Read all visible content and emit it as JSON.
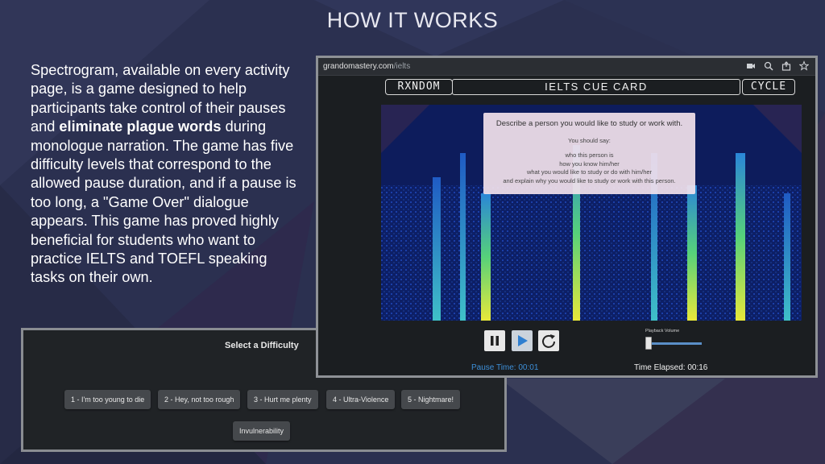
{
  "slide": {
    "title": "HOW IT WORKS",
    "intro_part1": "Spectrogram, available on every activity page, is a game designed to help participants take control of their pauses and ",
    "intro_bold": "eliminate plague words",
    "intro_part2": " during monologue narration. The game has five difficulty levels that correspond to the allowed pause duration, and if a pause is too long, a \"Game Over\" dialogue appears. This game has proved highly beneficial for students who want to practice IELTS and TOEFL speaking tasks on their own."
  },
  "difficulty": {
    "title": "Select a Difficulty",
    "options": [
      "1 - I'm too young to die",
      "2 - Hey, not too rough",
      "3 - Hurt me plenty",
      "4 - Ultra-Violence",
      "5 - Nightmare!",
      "Invulnerability"
    ]
  },
  "browser": {
    "url_domain": "grandomastery.com",
    "url_path": "/ielts",
    "icons": [
      "camera-icon",
      "zoom-icon",
      "share-icon",
      "star-icon"
    ]
  },
  "app": {
    "random_label": "RXNDOM",
    "title": "IELTS CUE CARD",
    "cycle_label": "CYCLE",
    "cue_card": {
      "question": "Describe a person you would like to study or work with.",
      "you_should_say": "You should say:",
      "points": [
        "who this person is",
        "how you know him/her",
        "what you would like to study or do with him/her",
        "and explain why you would like to study or work with this person."
      ]
    },
    "controls": {
      "buttons": [
        "pause-icon",
        "play-icon",
        "restart-icon"
      ],
      "volume_label": "Playback Volume",
      "volume_level": 0.0,
      "pause_time": "Pause Time: 00:01",
      "time_elapsed": "Time Elapsed: 00:16"
    }
  },
  "colors": {
    "background": "#2a2f4a",
    "accent_blue": "#3d8fd8",
    "spectrogram_bg": "#0d1f66"
  }
}
